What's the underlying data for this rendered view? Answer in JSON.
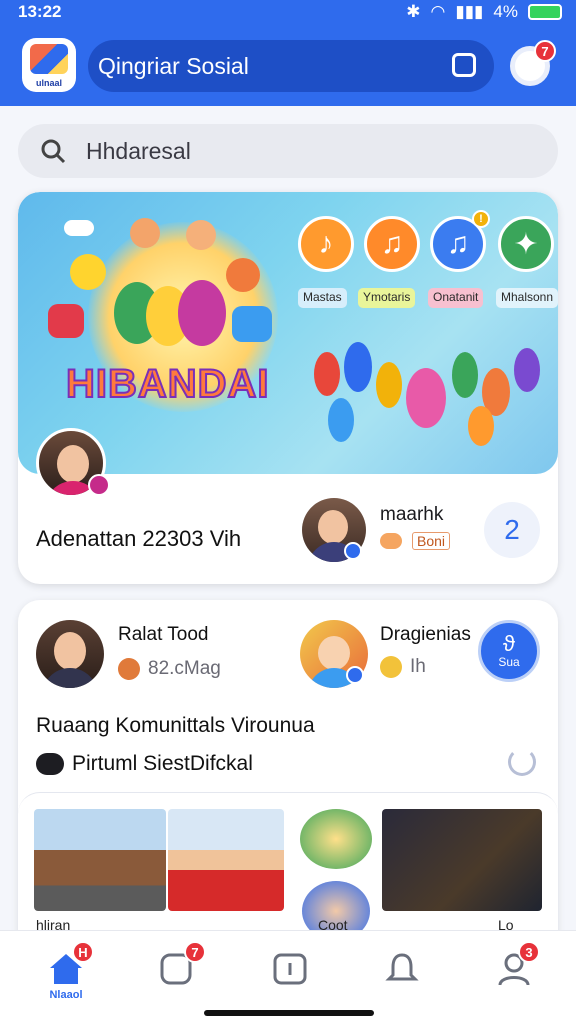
{
  "status_bar": {
    "time": "13:22",
    "battery_text": "4%"
  },
  "header": {
    "app_logo_text": "ulnaal",
    "title": "Qingriar Sosial",
    "notification_count": "7"
  },
  "search": {
    "placeholder": "Hhdaresal"
  },
  "hero": {
    "banner_title": "HIBANDAI",
    "category_chips": [
      "Mastas",
      "Ymotaris",
      "Onatanit",
      "Mhalsonn"
    ],
    "music_badge": "!",
    "caption": "Adenattan 22303  Vih",
    "user_name": "maarhk",
    "user_sub": "Boni",
    "count": "2"
  },
  "community": {
    "members": [
      {
        "name": "Ralat Tood",
        "sub": "82.cMag"
      },
      {
        "name": "Dragienias",
        "sub": "Ih"
      }
    ],
    "join_label": "Sua",
    "title": "Ruaang Komunittals Virounua",
    "subtitle": "Pirtuml SiestDifckal",
    "gallery_labels": [
      "hliran",
      "Coot",
      "Lo"
    ]
  },
  "bottom_nav": {
    "home_label": "Nlaaol",
    "badges": {
      "home": "H",
      "chat": "7",
      "profile": "3"
    }
  },
  "colors": {
    "primary": "#2f6bed",
    "badge": "#e7323a",
    "banner": "#6cc5ee"
  }
}
